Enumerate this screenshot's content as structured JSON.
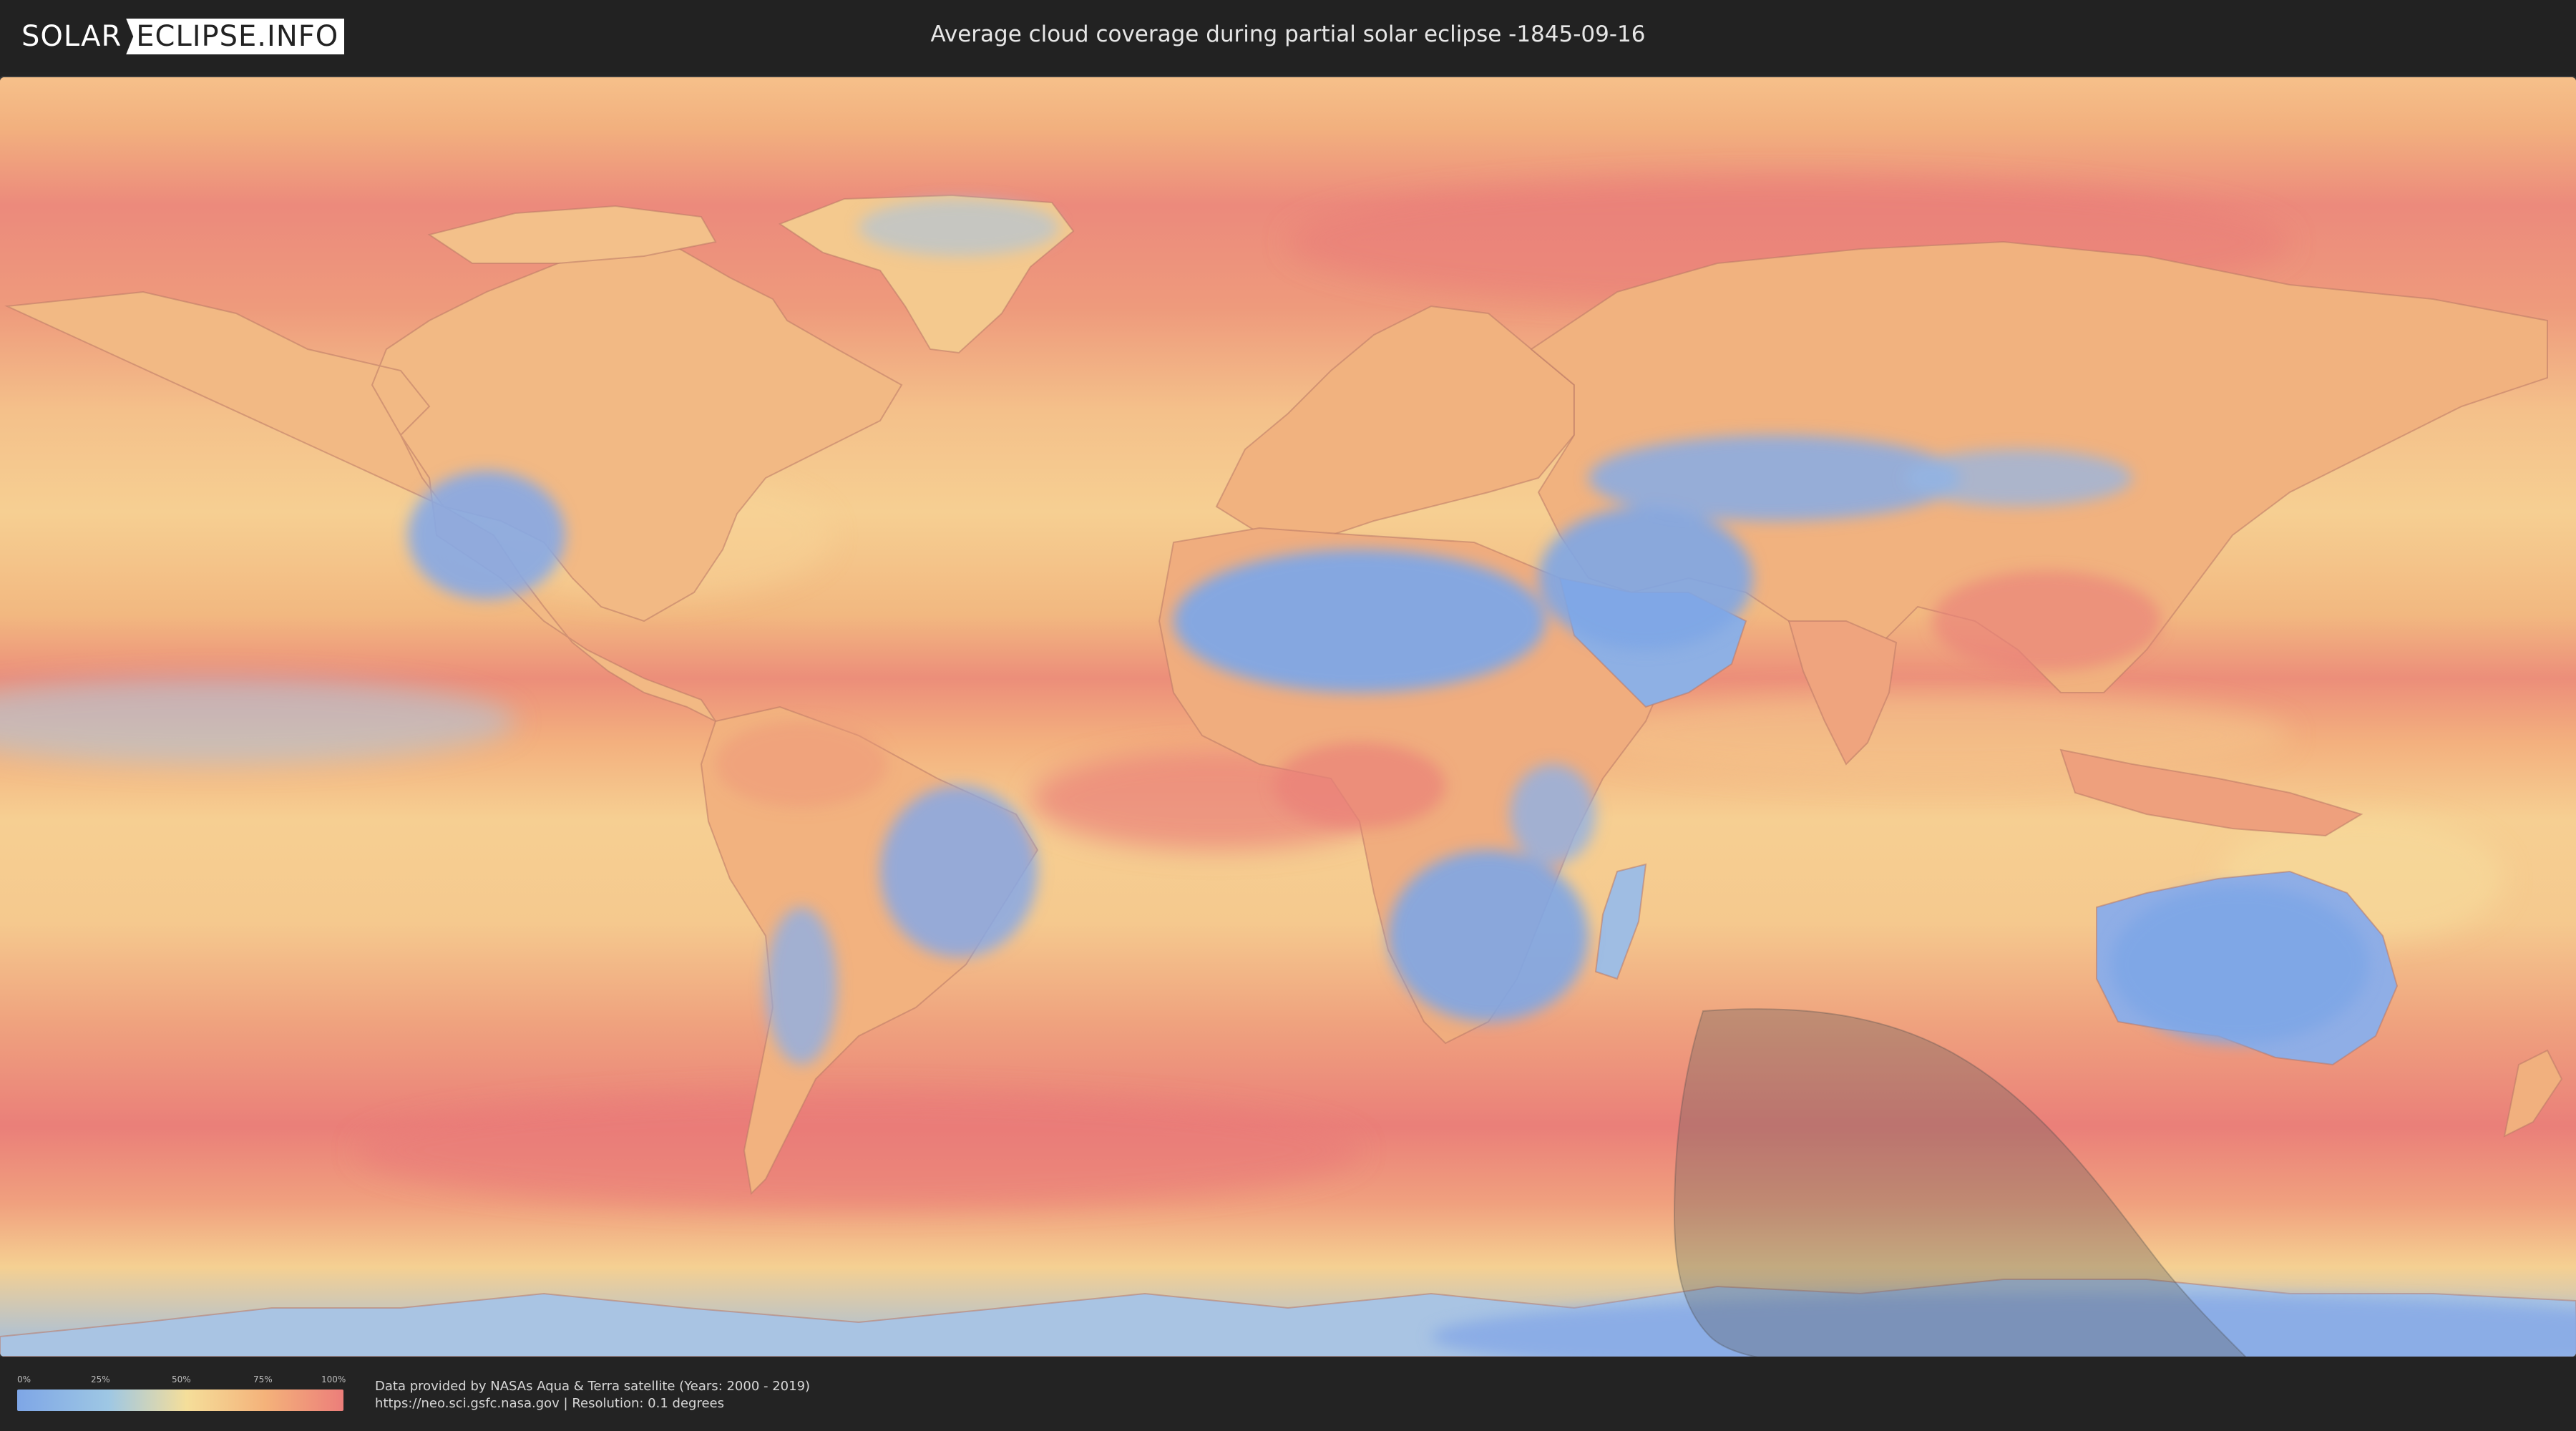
{
  "header": {
    "logo_left": "SOLAR",
    "logo_right": "ECLIPSE.INFO",
    "title": "Average cloud coverage during partial solar eclipse -1845-09-16"
  },
  "legend": {
    "ticks": [
      "0%",
      "25%",
      "50%",
      "75%",
      "100%"
    ],
    "colors": {
      "low": "#7ea6e6",
      "mid_low": "#9ec7e4",
      "mid": "#f5de9a",
      "mid_high": "#f4b27a",
      "high": "#ec7e7a"
    }
  },
  "credits": {
    "line1": "Data provided by NASAs Aqua & Terra satellite (Years: 2000 - 2019)",
    "line2": "https://neo.sci.gsfc.nasa.gov | Resolution: 0.1 degrees"
  },
  "map": {
    "projection": "equirectangular",
    "eclipse_visibility_region": "partial",
    "colors": {
      "clear": "#7ea6e6",
      "cloudy": "#ec7e7a",
      "medium": "#f5d592",
      "eclipse_shadow": "#5a5a5a"
    }
  }
}
